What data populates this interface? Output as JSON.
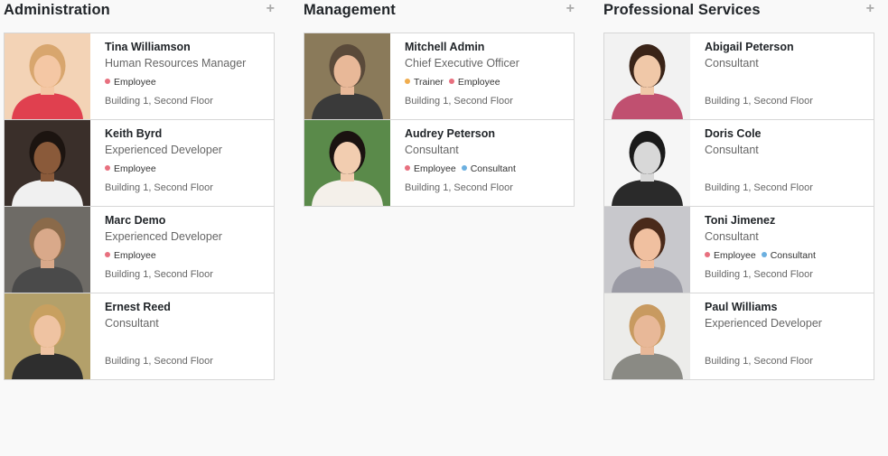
{
  "columns": [
    {
      "title": "Administration",
      "add_label": "+",
      "cards": [
        {
          "name": "Tina Williamson",
          "job": "Human Resources Manager",
          "tags": [
            {
              "label": "Employee",
              "color": "#e8707f"
            }
          ],
          "location": "Building 1, Second Floor",
          "photo": {
            "bg": "#f3d3b6",
            "hair": "#d8a66e",
            "skin": "#f4c7a4",
            "shirt": "#e0404f"
          }
        },
        {
          "name": "Keith Byrd",
          "job": "Experienced Developer",
          "tags": [
            {
              "label": "Employee",
              "color": "#e8707f"
            }
          ],
          "location": "Building 1, Second Floor",
          "photo": {
            "bg": "#3a2f2a",
            "hair": "#1c1410",
            "skin": "#8a5a3a",
            "shirt": "#f0f0f0"
          }
        },
        {
          "name": "Marc Demo",
          "job": "Experienced Developer",
          "tags": [
            {
              "label": "Employee",
              "color": "#e8707f"
            }
          ],
          "location": "Building 1, Second Floor",
          "photo": {
            "bg": "#6e6b66",
            "hair": "#8a6a4a",
            "skin": "#d9a98a",
            "shirt": "#4a4a4a"
          }
        },
        {
          "name": "Ernest Reed",
          "job": "Consultant",
          "tags": [],
          "location": "Building 1, Second Floor",
          "photo": {
            "bg": "#b3a06a",
            "hair": "#c8a060",
            "skin": "#efc3a2",
            "shirt": "#2e2e2e"
          }
        }
      ]
    },
    {
      "title": "Management",
      "add_label": "+",
      "cards": [
        {
          "name": "Mitchell Admin",
          "job": "Chief Executive Officer",
          "tags": [
            {
              "label": "Trainer",
              "color": "#f0ad4e"
            },
            {
              "label": "Employee",
              "color": "#e8707f"
            }
          ],
          "location": "Building 1, Second Floor",
          "photo": {
            "bg": "#8a7a5a",
            "hair": "#5a4a3a",
            "skin": "#e8b898",
            "shirt": "#3a3a3a"
          }
        },
        {
          "name": "Audrey Peterson",
          "job": "Consultant",
          "tags": [
            {
              "label": "Employee",
              "color": "#e8707f"
            },
            {
              "label": "Consultant",
              "color": "#6cb0e0"
            }
          ],
          "location": "Building 1, Second Floor",
          "photo": {
            "bg": "#5a8a4a",
            "hair": "#1a1210",
            "skin": "#f2cdb0",
            "shirt": "#f4f0ea"
          }
        }
      ]
    },
    {
      "title": "Professional Services",
      "add_label": "+",
      "cards": [
        {
          "name": "Abigail Peterson",
          "job": "Consultant",
          "tags": [],
          "location": "Building 1, Second Floor",
          "photo": {
            "bg": "#f2f2f2",
            "hair": "#3a2418",
            "skin": "#f0c8a8",
            "shirt": "#c05070"
          }
        },
        {
          "name": "Doris Cole",
          "job": "Consultant",
          "tags": [],
          "location": "Building 1, Second Floor",
          "photo": {
            "bg": "#f6f6f6",
            "hair": "#1a1a1a",
            "skin": "#d8d8d8",
            "shirt": "#2a2a2a"
          }
        },
        {
          "name": "Toni Jimenez",
          "job": "Consultant",
          "tags": [
            {
              "label": "Employee",
              "color": "#e8707f"
            },
            {
              "label": "Consultant",
              "color": "#6cb0e0"
            }
          ],
          "location": "Building 1, Second Floor",
          "photo": {
            "bg": "#c8c8cc",
            "hair": "#4a2a1a",
            "skin": "#f0c0a0",
            "shirt": "#9a9aa4"
          }
        },
        {
          "name": "Paul Williams",
          "job": "Experienced Developer",
          "tags": [],
          "location": "Building 1, Second Floor",
          "photo": {
            "bg": "#ececea",
            "hair": "#c89a60",
            "skin": "#e8b898",
            "shirt": "#8a8a84"
          }
        }
      ]
    }
  ]
}
